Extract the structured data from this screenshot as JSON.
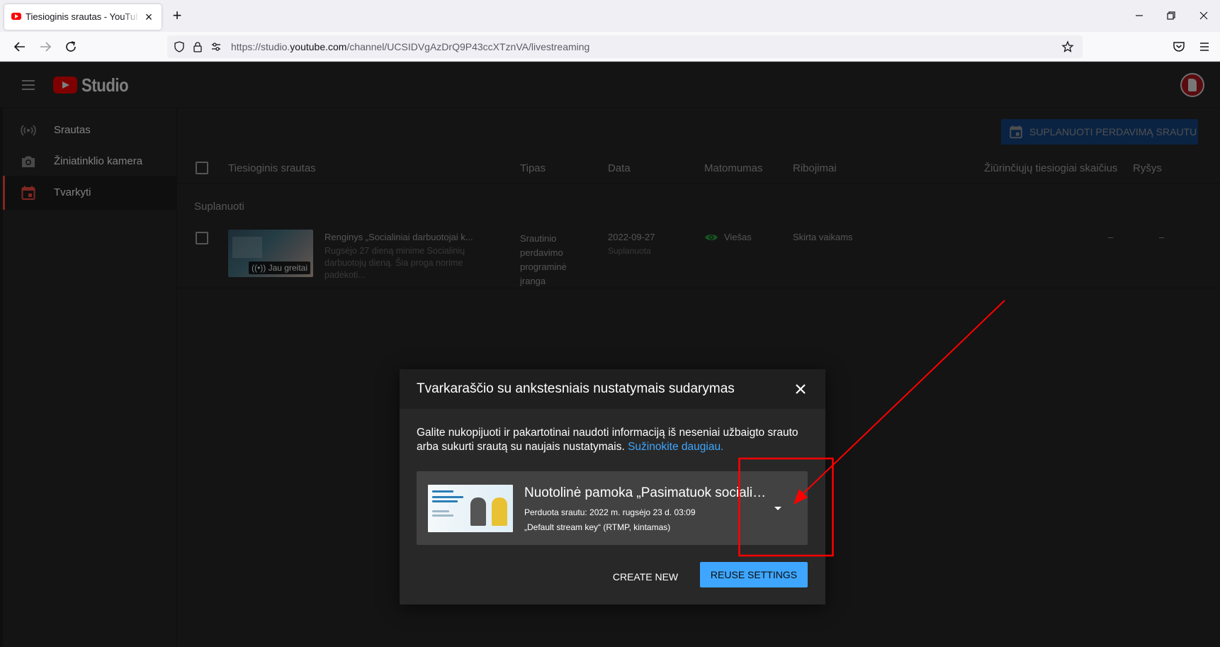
{
  "browser": {
    "tab_title": "Tiesioginis srautas - YouTube Studio",
    "url_prefix": "https://studio.",
    "url_host": "youtube.com",
    "url_path": "/channel/UCSIDVgAzDrQ9P43ccXTznVA/livestreaming"
  },
  "studio": {
    "logo_text": "Studio",
    "sidebar": [
      {
        "label": "Srautas",
        "icon": "broadcast-icon"
      },
      {
        "label": "Žiniatinklio kamera",
        "icon": "camera-icon"
      },
      {
        "label": "Tvarkyti",
        "icon": "calendar-icon",
        "active": true
      }
    ],
    "schedule_button": "SUPLANUOTI PERDAVIMĄ SRAUTU",
    "table": {
      "headers": [
        "Tiesioginis srautas",
        "Tipas",
        "Data",
        "Matomumas",
        "Ribojimai",
        "Žiūrinčiųjų tiesiogiai skaičius",
        "Ryšys"
      ],
      "section": "Suplanuoti",
      "row": {
        "title": "Renginys „Socialiniai darbuotojai k...",
        "description": "Rugsėjo 27 dieną minime Socialinių darbuotojų dieną. Šia proga norime padėkoti...",
        "thumb_badge": "Jau greitai",
        "type": "Srautinio perdavimo programinė įranga",
        "date": "2022-09-27",
        "date_status": "Suplanuota",
        "visibility": "Viešas",
        "restrictions": "Skirta vaikams",
        "viewers": "–",
        "connection": "–"
      }
    }
  },
  "modal": {
    "title": "Tvarkaraščio su ankstesniais nustatymais sudarymas",
    "text": "Galite nukopijuoti ir pakartotinai naudoti informaciją iš neseniai užbaigto srauto arba sukurti srautą su naujais nustatymais.",
    "link": "Sužinokite daugiau.",
    "stream": {
      "title": "Nuotolinė pamoka „Pasimatuok socialinio darbuotojo profesiją“",
      "streamed": "Perduota srautu: 2022 m. rugsėjo 23 d. 03:09",
      "key": "„Default stream key“ (RTMP, kintamas)"
    },
    "create_new": "CREATE NEW",
    "reuse": "REUSE SETTINGS"
  },
  "colors": {
    "accent_blue": "#3ea6ff",
    "brand_red": "#ff0000",
    "annotation_red": "#ff0000",
    "visibility_green": "#2ba640"
  }
}
